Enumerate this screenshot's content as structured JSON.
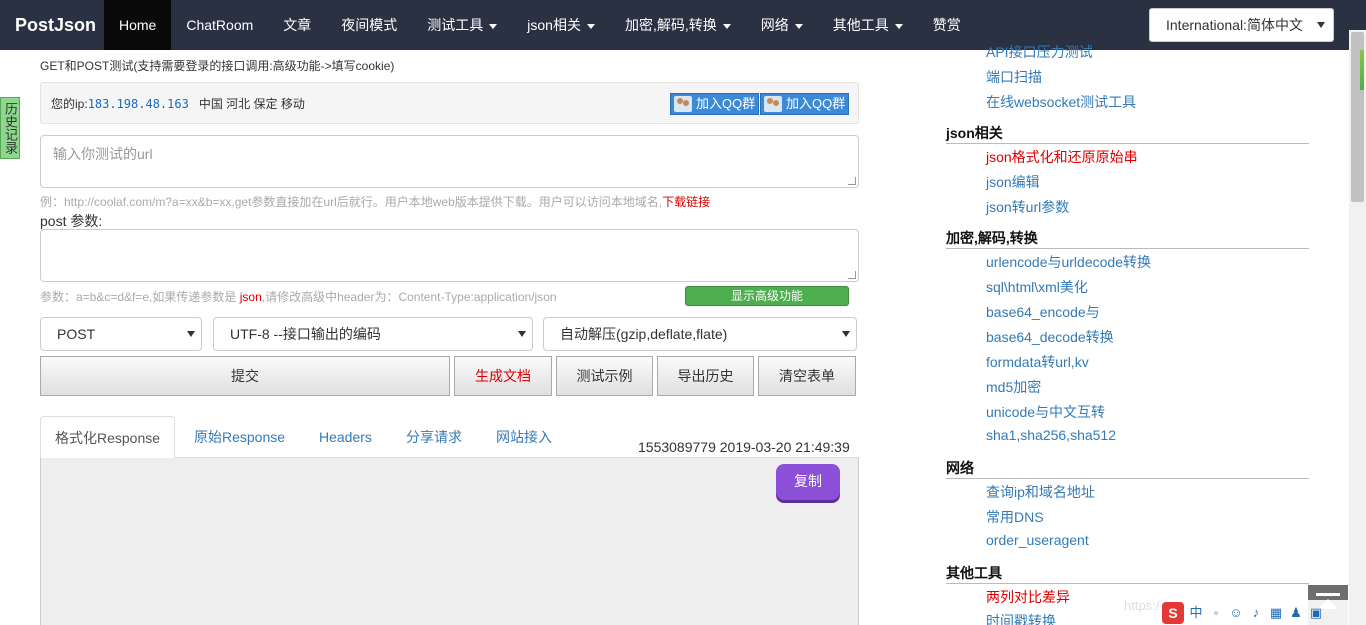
{
  "nav": {
    "brand": "PostJson",
    "items": [
      {
        "label": "Home",
        "dropdown": false,
        "active": true
      },
      {
        "label": "ChatRoom",
        "dropdown": false
      },
      {
        "label": "文章",
        "dropdown": false
      },
      {
        "label": "夜间模式",
        "dropdown": false
      },
      {
        "label": "测试工具",
        "dropdown": true
      },
      {
        "label": "json相关",
        "dropdown": true
      },
      {
        "label": "加密,解码,转换",
        "dropdown": true
      },
      {
        "label": "网络",
        "dropdown": true
      },
      {
        "label": "其他工具",
        "dropdown": true
      },
      {
        "label": "赞赏",
        "dropdown": false
      }
    ],
    "language": "International:简体中文"
  },
  "history_tab": "历史记录",
  "subtitle": "GET和POST测试(支持需要登录的接口调用:高级功能->填写cookie)",
  "ip": {
    "label": "您的ip:",
    "value": "183.198.48.163",
    "location": "中国 河北 保定 移动",
    "qq_button": "加入QQ群"
  },
  "url_input": {
    "placeholder": "输入你测试的url"
  },
  "url_hint": {
    "text": "例：http://coolaf.com/m?a=xx&b=xx,get参数直接加在url后就行。用户本地web版本提供下载。用户可以访问本地域名,",
    "link": "下载链接"
  },
  "post_label": "post 参数:",
  "params_hint": {
    "prefix": "参数：a=b&c=d&f=e,如果传递参数是 ",
    "red": "json",
    "suffix": ",请修改高级中header为：Content-Type:application/json"
  },
  "advanced_button": "显示高级功能",
  "selects": {
    "method": "POST",
    "encoding": "UTF-8 --接口输出的编码",
    "decompress": "自动解压(gzip,deflate,flate)"
  },
  "buttons": {
    "submit": "提交",
    "gen_doc": "生成文档",
    "example": "测试示例",
    "export": "导出历史",
    "clear": "清空表单"
  },
  "tabs": [
    "格式化Response",
    "原始Response",
    "Headers",
    "分享请求",
    "网站接入"
  ],
  "timestamp": "1553089779 2019-03-20 21:49:39",
  "copy_button": "复制",
  "sidebar": {
    "top_links": [
      "API接口压力测试",
      "端口扫描",
      "在线websocket测试工具"
    ],
    "categories": [
      {
        "title": "json相关",
        "links": [
          {
            "label": "json格式化和还原原始串",
            "red": true
          },
          {
            "label": "json编辑"
          },
          {
            "label": "json转url参数"
          }
        ]
      },
      {
        "title": "加密,解码,转换",
        "links": [
          {
            "label": "urlencode与urldecode转换"
          },
          {
            "label": "sql\\html\\xml美化"
          },
          {
            "label": "base64_encode与"
          },
          {
            "label": "base64_decode转换"
          },
          {
            "label": "formdata转url,kv"
          },
          {
            "label": "md5加密"
          },
          {
            "label": "unicode与中文互转"
          },
          {
            "label": "sha1,sha256,sha512"
          }
        ]
      },
      {
        "title": "网络",
        "links": [
          {
            "label": "查询ip和域名地址"
          },
          {
            "label": "常用DNS"
          },
          {
            "label": "order_useragent"
          }
        ]
      },
      {
        "title": "其他工具",
        "links": [
          {
            "label": "两列对比差异",
            "red": true
          },
          {
            "label": "时间戳转换"
          }
        ]
      }
    ]
  },
  "ime": {
    "logo": "S",
    "lang": "中"
  },
  "watermark": "https://"
}
